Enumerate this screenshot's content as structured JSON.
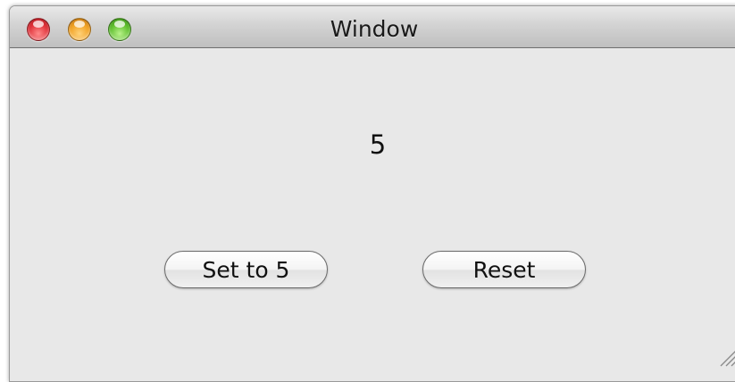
{
  "window": {
    "title": "Window",
    "controls": [
      "close",
      "minimize",
      "zoom"
    ]
  },
  "main": {
    "value_label": "5",
    "buttons": {
      "set_label": "Set to 5",
      "reset_label": "Reset"
    }
  },
  "colors": {
    "window_bg": "#e8e8e8",
    "close": "#e0323a",
    "minimize": "#f1a224",
    "zoom": "#5fbf2e"
  },
  "icons": {
    "close": "close-icon",
    "minimize": "minimize-icon",
    "zoom": "zoom-icon",
    "resize": "resize-grip-icon"
  }
}
